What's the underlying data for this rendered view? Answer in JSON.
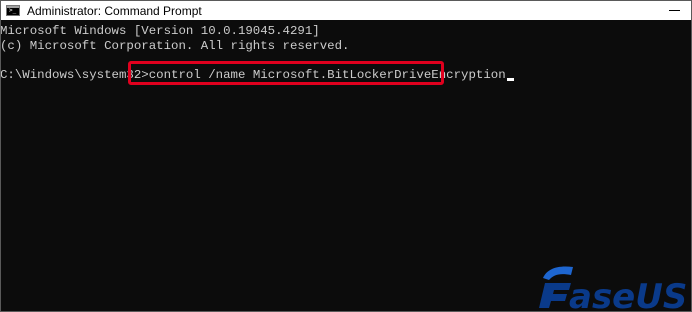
{
  "window": {
    "title": "Administrator: Command Prompt",
    "app_icon": "cmd-icon",
    "app_icon_glyph": ">_",
    "controls": [
      "minimize-icon"
    ]
  },
  "console": {
    "line1": "Microsoft Windows [Version 10.0.19045.4291]",
    "line2": "(c) Microsoft Corporation. All rights reserved.",
    "prompt": "C:\\Windows\\system32>",
    "command": "control /name Microsoft.BitLockerDriveEncryption"
  },
  "highlight": {
    "target": "command",
    "color": "#e0001e"
  },
  "watermark": {
    "text": "EaseUS",
    "colors": {
      "primary": "#0a3a8a",
      "accent": "#1e66d0"
    }
  }
}
